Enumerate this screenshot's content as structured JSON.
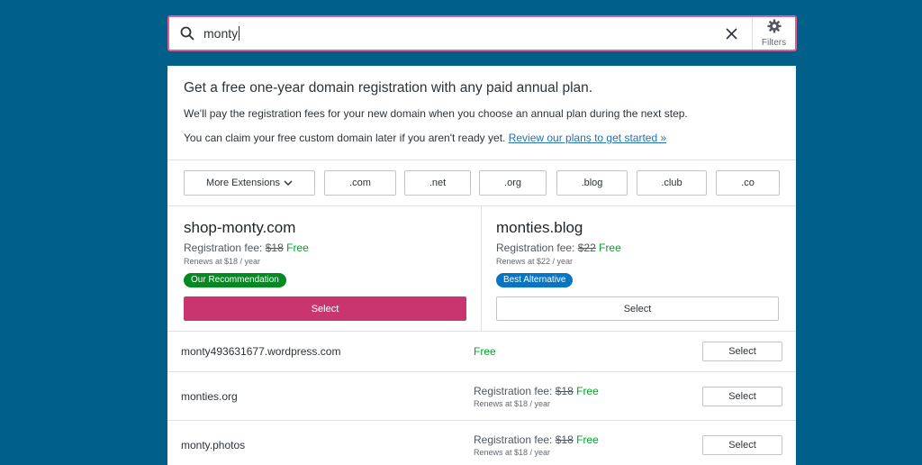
{
  "search": {
    "query": "monty",
    "filters_label": "Filters"
  },
  "promo": {
    "title": "Get a free one-year domain registration with any paid annual plan.",
    "line1": "We'll pay the registration fees for your new domain when you choose an annual plan during the next step.",
    "line2": "You can claim your free custom domain later if you aren't ready yet.",
    "link": "Review our plans to get started »"
  },
  "tlds": {
    "more": "More Extensions",
    "items": [
      ".com",
      ".net",
      ".org",
      ".blog",
      ".club",
      ".co"
    ]
  },
  "featured": [
    {
      "domain": "shop-monty.com",
      "fee_label": "Registration fee:",
      "old_price": "$18",
      "free": "Free",
      "renews": "Renews at $18 / year",
      "badge": "Our Recommendation",
      "button": "Select"
    },
    {
      "domain": "monties.blog",
      "fee_label": "Registration fee:",
      "old_price": "$22",
      "free": "Free",
      "renews": "Renews at $22 / year",
      "badge": "Best Alternative",
      "button": "Select"
    }
  ],
  "results": [
    {
      "domain": "monty493631677.wordpress.com",
      "free": "Free",
      "button": "Select"
    },
    {
      "domain": "monties.org",
      "fee_label": "Registration fee:",
      "old_price": "$18",
      "free": "Free",
      "renews": "Renews at $18 / year",
      "button": "Select"
    },
    {
      "domain": "monty.photos",
      "fee_label": "Registration fee:",
      "old_price": "$18",
      "free": "Free",
      "renews": "Renews at $18 / year",
      "button": "Select"
    }
  ],
  "colors": {
    "background": "#01608a",
    "primary_button": "#c9356e",
    "search_border": "#d95e9a",
    "free_text": "#00a32a",
    "badge_green": "#008a20",
    "badge_blue": "#0675c4",
    "link": "#2271b1"
  }
}
